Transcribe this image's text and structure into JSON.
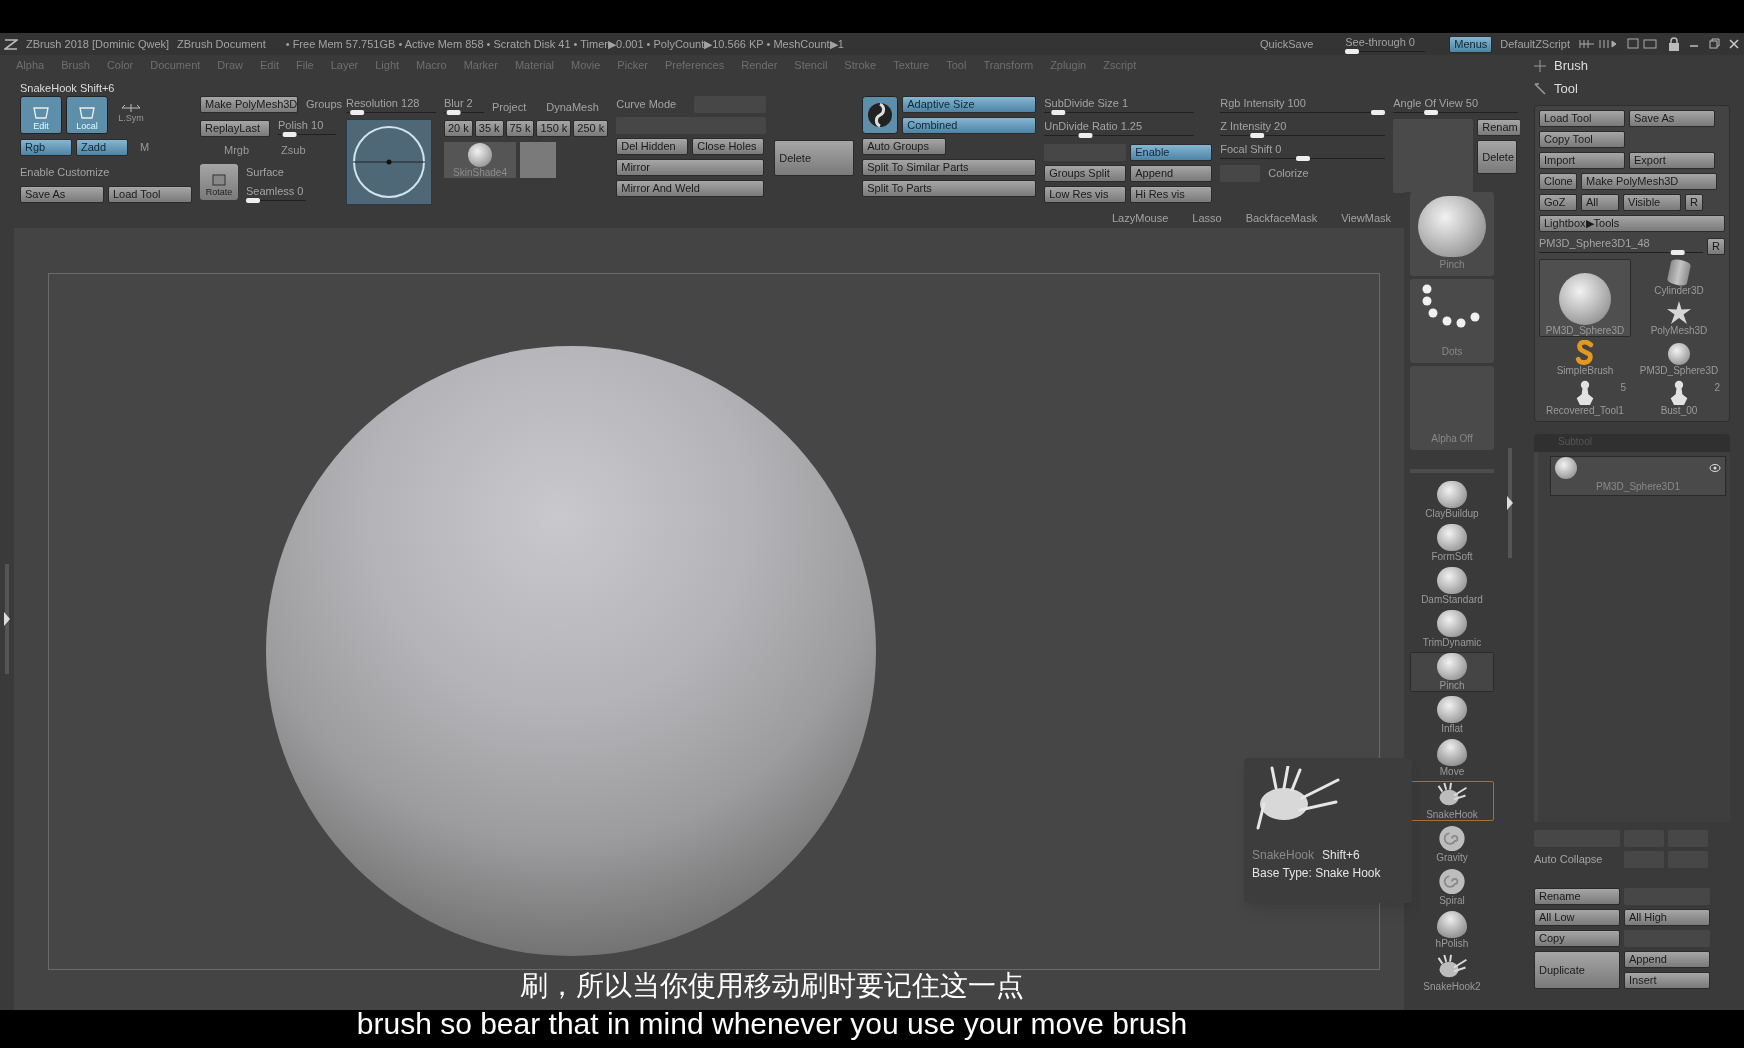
{
  "title_bar": {
    "app": "ZBrush 2018 [Dominic Qwek]",
    "document": "ZBrush Document",
    "stats": "• Free Mem 57.751GB • Active Mem 858 • Scratch Disk 41 • Timer▶0.001 • PolyCount▶10.566 KP • MeshCount▶1",
    "quicksave": "QuickSave",
    "see_through": {
      "label": "See-through  0",
      "level": 0
    },
    "menus": {
      "label": "Menus",
      "on": true
    },
    "script": "DefaultZScript"
  },
  "menu_bar": [
    "Alpha",
    "Brush",
    "Color",
    "Document",
    "Draw",
    "Edit",
    "File",
    "Layer",
    "Light",
    "Macro",
    "Marker",
    "Material",
    "Movie",
    "Picker",
    "Preferences",
    "Render",
    "Stencil",
    "Stroke",
    "Texture",
    "Tool",
    "Transform",
    "Zplugin",
    "Zscript"
  ],
  "status_line": "SnakeHook Shift+6",
  "toolbar": {
    "edit": {
      "label": "Edit",
      "on": true
    },
    "local": {
      "label": "Local",
      "on": true
    },
    "lsym": {
      "label": "L.Sym",
      "on": false
    },
    "rgb": {
      "label": "Rgb",
      "on": true
    },
    "zadd": {
      "label": "Zadd",
      "on": true
    },
    "m": "M",
    "enable_customize": "Enable Customize",
    "save_as": "Save As",
    "load_tool": "Load Tool",
    "make_polymesh": "Make PolyMesh3D",
    "groups": "Groups",
    "replay_last": "ReplayLast",
    "polish": {
      "label": "Polish 10",
      "level": 0.1
    },
    "mrgb": "Mrgb",
    "zsub": "Zsub",
    "rotate": "Rotate",
    "surface": "Surface",
    "seamless": {
      "label": "Seamless 0",
      "level": 0
    },
    "resolution": {
      "label": "Resolution 128",
      "level": 0.06
    },
    "blur": {
      "label": "Blur 2",
      "level": 0.1
    },
    "project": "Project",
    "dynamesh": "DynaMesh",
    "resolutions": [
      "20 k",
      "35 k",
      "75 k",
      "150 k",
      "250 k"
    ],
    "material": "SkinShade4",
    "curve_mode": "Curve Mode",
    "del_hidden": "Del Hidden",
    "close_holes": "Close Holes",
    "delete": "Delete",
    "mirror": "Mirror",
    "mirror_weld": "Mirror And Weld",
    "adaptive_size": {
      "label": "Adaptive Size",
      "on": true
    },
    "combined": {
      "label": "Combined",
      "on": true
    },
    "auto_groups": "Auto Groups",
    "split_similar": "Split To Similar Parts",
    "split_parts": "Split To Parts",
    "subdivide_size": {
      "label": "SubDivide Size 1",
      "level": 0.05
    },
    "undivide_ratio": {
      "label": "UnDivide Ratio 1.25",
      "level": 0.25
    },
    "enable": {
      "label": "Enable",
      "on": true
    },
    "groups_split": "Groups Split",
    "append": "Append",
    "low_res": "Low Res vis",
    "hi_res": "Hi Res vis",
    "rgb_intensity": {
      "label": "Rgb Intensity 100",
      "level": 1
    },
    "z_intensity": {
      "label": "Z Intensity 20",
      "level": 0.2
    },
    "focal_shift": {
      "label": "Focal Shift 0",
      "level": 0.5
    },
    "colorize": "Colorize",
    "bottom_labels": [
      "LazyMouse",
      "Lasso",
      "BackfaceMask",
      "ViewMask"
    ],
    "angle_of_view": {
      "label": "Angle Of View 50",
      "level": 0.28
    },
    "rename": "Renam",
    "delete_view": "Delete"
  },
  "brush_palette": {
    "previews": [
      {
        "label": "Pinch",
        "kind": "sphere"
      },
      {
        "label": "Dots",
        "kind": "dots"
      },
      {
        "label": "Alpha Off",
        "kind": "blank"
      }
    ],
    "brushes": [
      {
        "label": "ClayBuildup",
        "kind": "sphere",
        "selected": false,
        "highlighted": false
      },
      {
        "label": "FormSoft",
        "kind": "sphere",
        "selected": false,
        "highlighted": false
      },
      {
        "label": "DamStandard",
        "kind": "sphere",
        "selected": false,
        "highlighted": false
      },
      {
        "label": "TrimDynamic",
        "kind": "sphere",
        "selected": false,
        "highlighted": false
      },
      {
        "label": "Pinch",
        "kind": "sphere",
        "selected": false,
        "highlighted": true
      },
      {
        "label": "Inflat",
        "kind": "sphere",
        "selected": false,
        "highlighted": false
      },
      {
        "label": "Move",
        "kind": "drop",
        "selected": false,
        "highlighted": false
      },
      {
        "label": "SnakeHook",
        "kind": "spiky",
        "selected": true,
        "highlighted": false
      },
      {
        "label": "Gravity",
        "kind": "swirl",
        "selected": false,
        "highlighted": false
      },
      {
        "label": "Spiral",
        "kind": "swirl",
        "selected": false,
        "highlighted": false
      },
      {
        "label": "hPolish",
        "kind": "drop",
        "selected": false,
        "highlighted": false
      },
      {
        "label": "SnakeHook2",
        "kind": "spiky",
        "selected": false,
        "highlighted": false
      }
    ]
  },
  "tooltip": {
    "name": "SnakeHook",
    "shortcut": "Shift+6",
    "base_type": "Base Type: Snake Hook"
  },
  "subtitles": {
    "chinese": "刷，所以当你使用移动刷时要记住这一点",
    "english": "brush so bear that in mind whenever you use your move brush"
  },
  "right_panel": {
    "brush_header": "Brush",
    "tool_header": "Tool",
    "button_rows": [
      [
        "Load Tool",
        "Save As"
      ],
      [
        "Copy Tool"
      ],
      [
        "Import",
        "Export"
      ],
      [
        "Clone",
        "Make PolyMesh3D"
      ],
      [
        "GoZ",
        "All",
        "Visible",
        "R"
      ]
    ],
    "lightbox": "Lightbox▶Tools",
    "current_tool": {
      "label": "PM3D_Sphere3D1_48",
      "level": 0.88
    },
    "current_r": "R",
    "tools": [
      {
        "label": "PM3D_Sphere3D",
        "kind": "sphere",
        "selected": true
      },
      {
        "label": "Cylinder3D",
        "kind": "cylinder",
        "selected": false
      },
      {
        "label": "PolyMesh3D",
        "kind": "star",
        "selected": false
      },
      {
        "label": "SimpleBrush",
        "kind": "snake",
        "selected": false
      },
      {
        "label": "PM3D_Sphere3D",
        "kind": "small-sphere",
        "selected": false
      },
      {
        "label": "Recovered_Tool1",
        "kind": "bust",
        "selected": false,
        "count": "5"
      },
      {
        "label": "Bust_00",
        "kind": "bust",
        "selected": false,
        "count": "2"
      }
    ],
    "subtool_header": "Subtool",
    "subtools": [
      {
        "label": "PM3D_Sphere3D1"
      }
    ],
    "auto_collapse": "Auto Collapse",
    "rename": "Rename",
    "all_low": "All Low",
    "all_high": "All High",
    "copy": "Copy",
    "duplicate": "Duplicate",
    "append": "Append",
    "insert": "Insert"
  }
}
